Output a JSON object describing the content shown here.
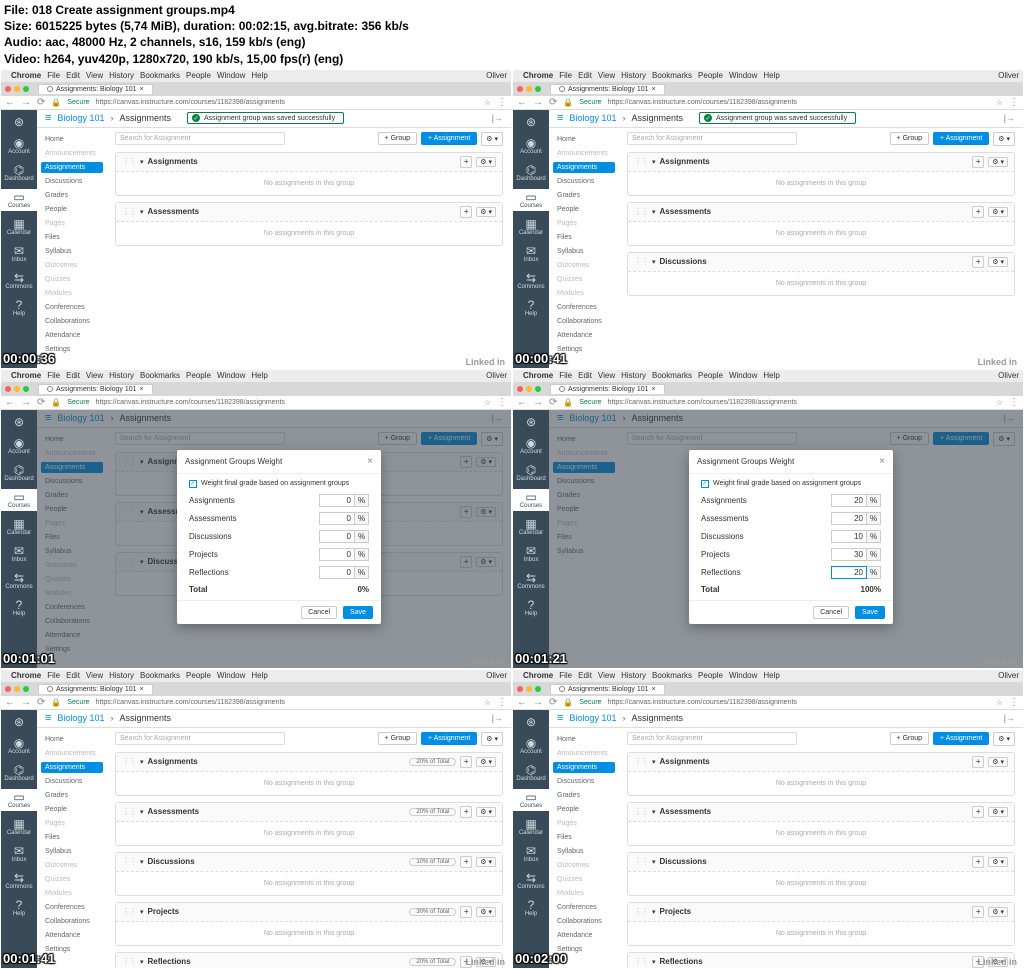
{
  "meta": {
    "file": "File: 018 Create assignment groups.mp4",
    "size": "Size: 6015225 bytes (5,74 MiB), duration: 00:02:15, avg.bitrate: 356 kb/s",
    "audio": "Audio: aac, 48000 Hz, 2 channels, s16, 159 kb/s (eng)",
    "video": "Video: h264, yuv420p, 1280x720, 190 kb/s, 15,00 fps(r) (eng)"
  },
  "menubar": {
    "items": [
      "Chrome",
      "File",
      "Edit",
      "View",
      "History",
      "Bookmarks",
      "People",
      "Window",
      "Help"
    ],
    "right": "Oliver"
  },
  "tab": "Assignments: Biology 101",
  "url": {
    "secure": "Secure",
    "host": "https",
    "path": "://canvas.instructure.com/courses/1182398/assignments"
  },
  "rail": [
    {
      "icon": "⊛",
      "label": ""
    },
    {
      "icon": "◉",
      "label": "Account"
    },
    {
      "icon": "⌬",
      "label": "Dashboard"
    },
    {
      "icon": "▭",
      "label": "Courses"
    },
    {
      "icon": "▦",
      "label": "Calendar"
    },
    {
      "icon": "✉",
      "label": "Inbox"
    },
    {
      "icon": "⇆",
      "label": "Commons"
    },
    {
      "icon": "?",
      "label": "Help"
    }
  ],
  "crumb": {
    "course": "Biology 101",
    "page": "Assignments"
  },
  "banner": "Assignment group was saved successfully",
  "coursenav": [
    "Home",
    "Announcements",
    "Assignments",
    "Discussions",
    "Grades",
    "People",
    "Pages",
    "Files",
    "Syllabus",
    "Outcomes",
    "Quizzes",
    "Modules",
    "Conferences",
    "Collaborations",
    "Attendance",
    "Settings"
  ],
  "toolbar": {
    "search": "Search for Assignment",
    "group_btn": "+ Group",
    "assign_btn": "+ Assignment"
  },
  "empty": "No assignments in this group",
  "f1": {
    "ts": "00:00:36",
    "groups": [
      "Assignments",
      "Assessments"
    ]
  },
  "f2": {
    "ts": "00:00:41",
    "groups": [
      "Assignments",
      "Assessments",
      "Discussions"
    ]
  },
  "modal": {
    "title": "Assignment Groups Weight",
    "chk": "Weight final grade based on assignment groups",
    "rows": [
      "Assignments",
      "Assessments",
      "Discussions",
      "Projects",
      "Reflections"
    ],
    "total_label": "Total",
    "cancel": "Cancel",
    "save": "Save"
  },
  "f3": {
    "ts": "00:01:01",
    "vals": [
      "0",
      "0",
      "0",
      "0",
      "0"
    ],
    "total": "0%"
  },
  "f4": {
    "ts": "00:01:21",
    "vals": [
      "20",
      "20",
      "10",
      "30",
      "20"
    ],
    "total": "100%"
  },
  "f5": {
    "ts": "00:01:41",
    "groups": [
      {
        "n": "Assignments",
        "p": "20% of Total"
      },
      {
        "n": "Assessments",
        "p": "20% of Total"
      },
      {
        "n": "Discussions",
        "p": "10% of Total"
      },
      {
        "n": "Projects",
        "p": "30% of Total"
      },
      {
        "n": "Reflections",
        "p": "20% of Total"
      }
    ]
  },
  "f6": {
    "ts": "00:02:00",
    "groups": [
      "Assignments",
      "Assessments",
      "Discussions",
      "Projects",
      "Reflections"
    ]
  },
  "linkedin": "Linked in"
}
